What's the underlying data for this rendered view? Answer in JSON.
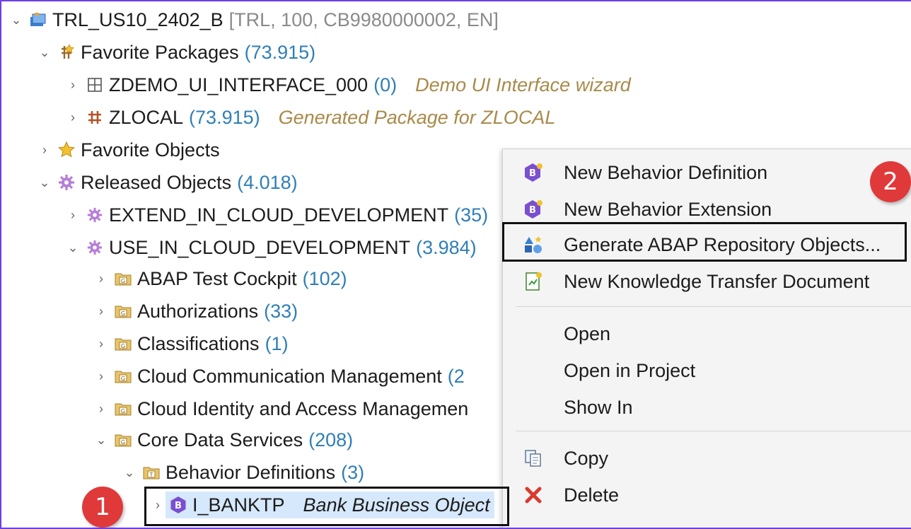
{
  "tree": {
    "project": {
      "label": "TRL_US10_2402_B",
      "meta": "[TRL, 100, CB9980000002, EN]"
    },
    "favorite_packages": {
      "label": "Favorite Packages",
      "count": "(73.915)"
    },
    "zdemo": {
      "label": "ZDEMO_UI_INTERFACE_000",
      "count": "(0)",
      "desc": "Demo UI Interface wizard"
    },
    "zlocal": {
      "label": "ZLOCAL",
      "count": "(73.915)",
      "desc": "Generated Package for ZLOCAL"
    },
    "favorite_objects": {
      "label": "Favorite Objects"
    },
    "released_objects": {
      "label": "Released Objects",
      "count": "(4.018)"
    },
    "extend": {
      "label": "EXTEND_IN_CLOUD_DEVELOPMENT",
      "count": "(35)"
    },
    "use": {
      "label": "USE_IN_CLOUD_DEVELOPMENT",
      "count": "(3.984)"
    },
    "atc": {
      "label": "ABAP Test Cockpit",
      "count": "(102)"
    },
    "auth": {
      "label": "Authorizations",
      "count": "(33)"
    },
    "class": {
      "label": "Classifications",
      "count": "(1)"
    },
    "ccm": {
      "label": "Cloud Communication Management",
      "count": "(2"
    },
    "ciam": {
      "label": "Cloud Identity and Access Managemen"
    },
    "cds": {
      "label": "Core Data Services",
      "count": "(208)"
    },
    "bdef": {
      "label": "Behavior Definitions",
      "count": "(3)"
    },
    "ibanktp": {
      "label": "I_BANKTP",
      "desc": "Bank Business Object"
    }
  },
  "menu": {
    "new_bdef": "New Behavior Definition",
    "new_bext": "New Behavior Extension",
    "generate": "Generate ABAP Repository Objects...",
    "new_ktd": "New Knowledge Transfer Document",
    "open": "Open",
    "open_in_project": "Open in Project",
    "show_in": "Show In",
    "copy": "Copy",
    "delete": "Delete"
  },
  "callouts": {
    "one": "1",
    "two": "2"
  },
  "colors": {
    "count": "#2f7fb6",
    "badge": "#e0393a",
    "selection": "#d6e8fb",
    "frame": "#6b3fe8"
  }
}
